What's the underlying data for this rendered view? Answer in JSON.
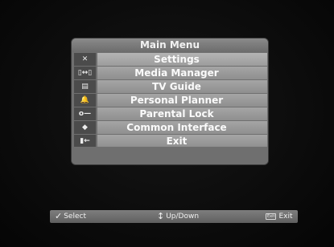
{
  "menu": {
    "title": "Main Menu",
    "items": [
      {
        "label": "Settings",
        "icon": "✕"
      },
      {
        "label": "Media Manager",
        "icon": "▯↔▯"
      },
      {
        "label": "TV Guide",
        "icon": "▤"
      },
      {
        "label": "Personal Planner",
        "icon": "🔔"
      },
      {
        "label": "Parental Lock",
        "icon": "o—"
      },
      {
        "label": "Common Interface",
        "icon": "◆"
      },
      {
        "label": "Exit",
        "icon": "▮←"
      }
    ]
  },
  "hints": {
    "select": "Select",
    "select_icon": "✓",
    "updown": "Up/Down",
    "updown_icon": "↕",
    "exit": "Exit",
    "exit_key": "Exit"
  },
  "colors": {
    "panel": "#6f6f6f",
    "item": "#9a9a9a",
    "icon_cell": "#4b4b4b",
    "background": "#0b0b0b"
  }
}
